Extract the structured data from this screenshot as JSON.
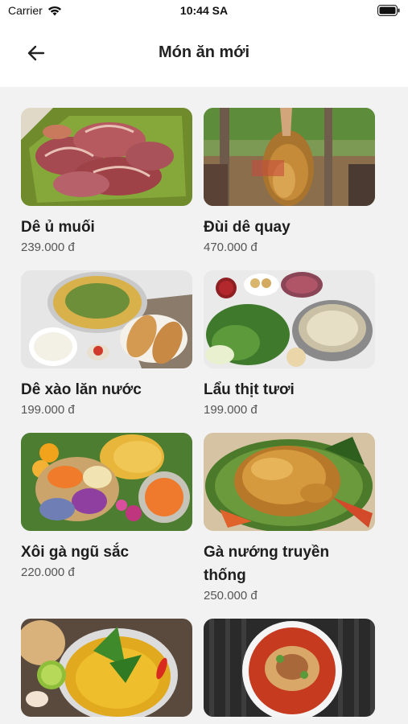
{
  "status_bar": {
    "carrier": "Carrier",
    "time": "10:44 SA"
  },
  "header": {
    "title": "Món ăn mới",
    "back_icon": "arrow-left-icon"
  },
  "dishes": [
    {
      "name": "Dê ủ muối",
      "price": "239.000 đ"
    },
    {
      "name": "Đùi dê quay",
      "price": "470.000 đ"
    },
    {
      "name": "Dê xào lăn nước",
      "price": "199.000 đ"
    },
    {
      "name": "Lẩu thịt tươi",
      "price": "199.000 đ"
    },
    {
      "name": "Xôi gà ngũ sắc",
      "price": "220.000 đ"
    },
    {
      "name": "Gà nướng truyền thống",
      "price": "250.000 đ"
    },
    {
      "name": "",
      "price": ""
    },
    {
      "name": "",
      "price": ""
    }
  ]
}
